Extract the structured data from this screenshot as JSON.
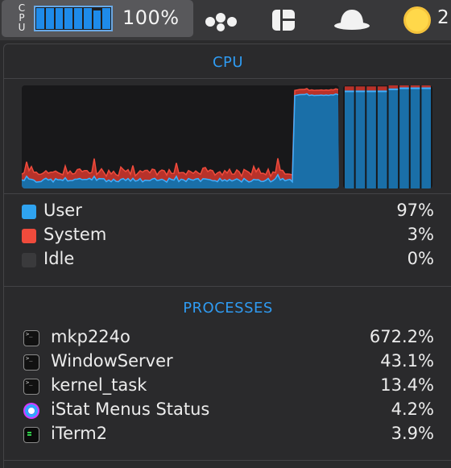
{
  "menubar": {
    "cpu_vertical_label": [
      "C",
      "P",
      "U"
    ],
    "cpu_percent": "100%",
    "core_bar_levels": [
      1.0,
      1.0,
      1.0,
      1.0,
      1.0,
      1.0,
      0.9,
      1.0
    ],
    "icons": [
      "dots-icon",
      "layout-icon",
      "hat-icon",
      "sun-icon"
    ],
    "trailing_text": "2"
  },
  "panel": {
    "cpu_title": "CPU",
    "legend": [
      {
        "label": "User",
        "value": "97%",
        "color": "#2fa3f0"
      },
      {
        "label": "System",
        "value": "3%",
        "color": "#ef4b3c"
      },
      {
        "label": "Idle",
        "value": "0%",
        "color": "#3a3a3c"
      }
    ],
    "processes_title": "PROCESSES",
    "processes": [
      {
        "name": "mkp224o",
        "value": "672.2%",
        "icon": "terminal-icon"
      },
      {
        "name": "WindowServer",
        "value": "43.1%",
        "icon": "terminal-icon"
      },
      {
        "name": "kernel_task",
        "value": "13.4%",
        "icon": "terminal-icon"
      },
      {
        "name": "iStat Menus Status",
        "value": "4.2%",
        "icon": "istat-icon"
      },
      {
        "name": "iTerm2",
        "value": "3.9%",
        "icon": "iterm-icon"
      }
    ]
  },
  "colors": {
    "accent": "#2f9bf2",
    "user": "#2fa3f0",
    "system": "#ef4b3c",
    "graph_bg": "#18181a"
  },
  "history_chart": {
    "user_low_level": 0.06,
    "system_low_level": 0.1,
    "user_high_level": 0.97,
    "system_high_level": 0.03
  },
  "core_meters": [
    {
      "user": 0.95,
      "system": 0.04
    },
    {
      "user": 0.95,
      "system": 0.04
    },
    {
      "user": 0.95,
      "system": 0.04
    },
    {
      "user": 0.95,
      "system": 0.04
    },
    {
      "user": 0.97,
      "system": 0.03
    },
    {
      "user": 0.98,
      "system": 0.02
    },
    {
      "user": 0.98,
      "system": 0.02
    },
    {
      "user": 0.98,
      "system": 0.02
    }
  ]
}
